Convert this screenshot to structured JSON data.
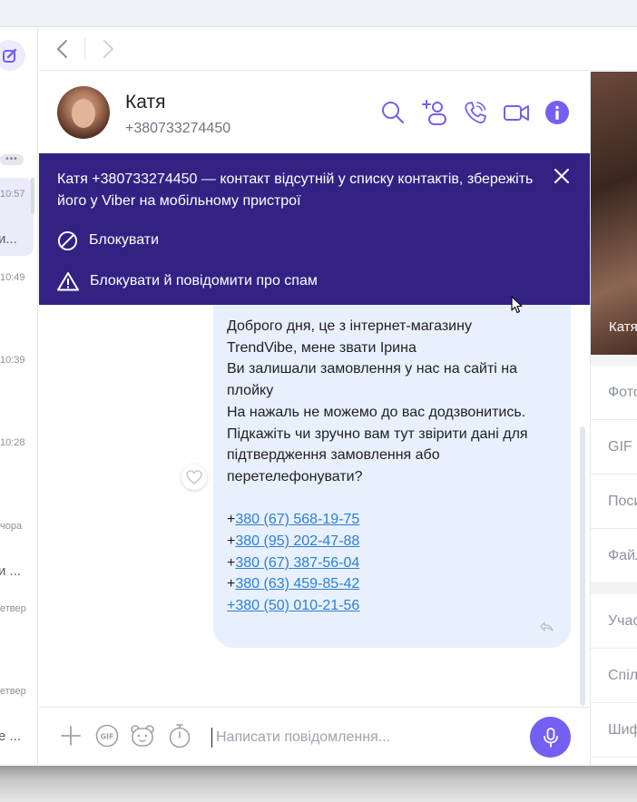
{
  "chat_list": {
    "items": [
      {
        "time": "10:57",
        "preview": "и..."
      },
      {
        "time": "10:49",
        "preview": ""
      },
      {
        "time": "10:39",
        "preview": ""
      },
      {
        "time": "10:28",
        "preview": ""
      },
      {
        "time": "чора",
        "preview": "и ..."
      },
      {
        "time": "етвер",
        "preview": ""
      },
      {
        "time": "етвер",
        "preview": "е ..."
      }
    ]
  },
  "header": {
    "name": "Катя",
    "phone": "+380733274450"
  },
  "banner": {
    "text": "Катя +380733274450 — контакт відсутній у списку контактів, збережіть його у Viber на мобільному пристрої",
    "block_label": "Блокувати",
    "report_label": "Блокувати й повідомити про спам"
  },
  "message": {
    "lines": [
      "Доброго дня, це з інтернет-магазину",
      "TrendVibe, мене звати Ірина",
      "Ви залишали замовлення у нас на сайті на",
      "плойку",
      "На нажаль не можемо до вас додзвонитись.",
      "Підкажіть чи зручно вам тут звірити дані для",
      "підтвердження замовлення або",
      "перетелефонувати?",
      ""
    ],
    "phones": [
      {
        "prefix": "+",
        "link": "380 (67) 568-19-75"
      },
      {
        "prefix": "+",
        "link": "380 (95) 202-47-88"
      },
      {
        "prefix": "+",
        "link": "380 (67) 387-56-04"
      },
      {
        "prefix": "+",
        "link": "380 (63) 459-85-42"
      },
      {
        "prefix": "",
        "link": "+380 (50) 010-21-56"
      }
    ]
  },
  "composer": {
    "placeholder": "Написати повідомлення..."
  },
  "right_panel": {
    "photo_caption": "Катя",
    "items": [
      "Фото",
      "GIF",
      "Посил",
      "Файли",
      "Учасн",
      "Спіль",
      "Шифр"
    ]
  },
  "colors": {
    "accent": "#7360f2",
    "banner": "#332284",
    "bubble": "#e8f0fd",
    "link": "#2b7fd6"
  }
}
